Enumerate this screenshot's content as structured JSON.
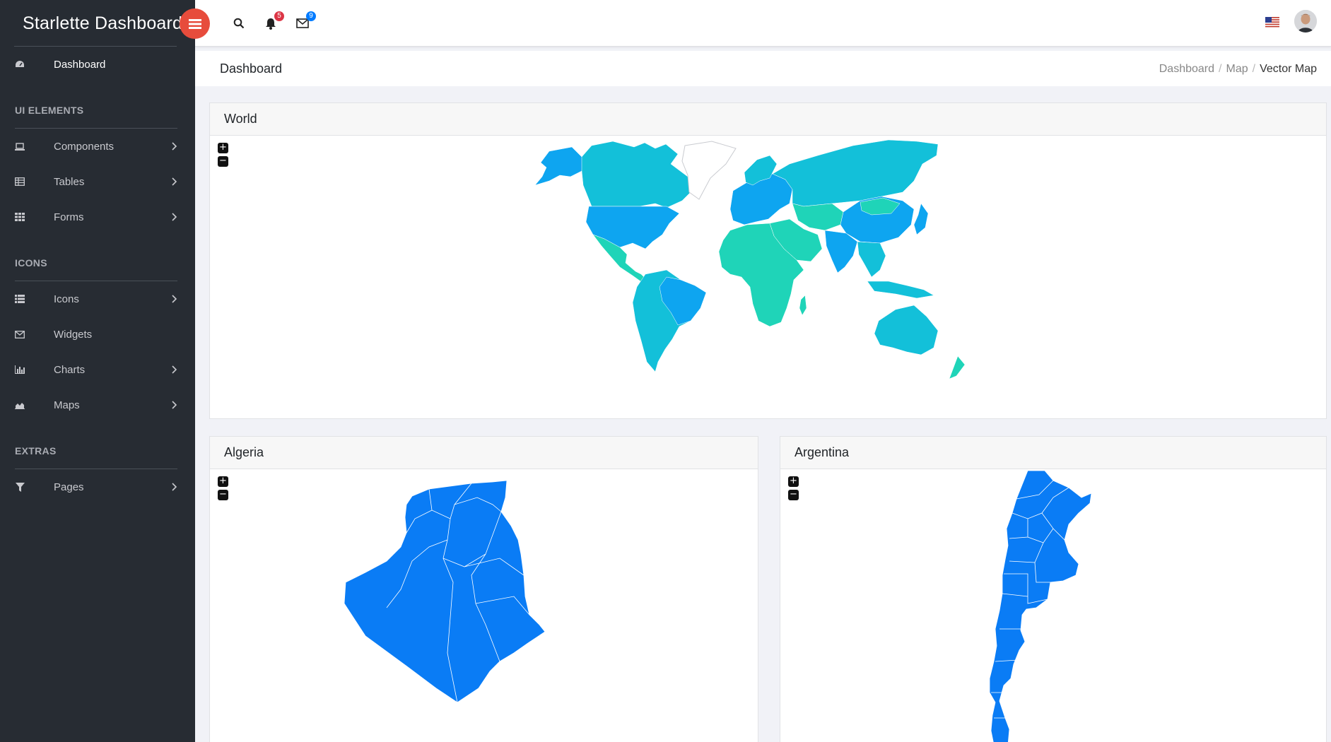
{
  "app": {
    "title": "Starlette Dashboard"
  },
  "sidebar": {
    "items": [
      {
        "label": "Dashboard",
        "icon": "dashboard-icon"
      },
      {
        "label": "Components",
        "icon": "laptop-icon"
      },
      {
        "label": "Tables",
        "icon": "table-icon"
      },
      {
        "label": "Forms",
        "icon": "grid-icon"
      },
      {
        "label": "Icons",
        "icon": "list-icon"
      },
      {
        "label": "Widgets",
        "icon": "envelope-icon"
      },
      {
        "label": "Charts",
        "icon": "bar-chart-icon"
      },
      {
        "label": "Maps",
        "icon": "area-chart-icon"
      },
      {
        "label": "Pages",
        "icon": "filter-icon"
      }
    ],
    "sections": [
      "UI ELEMENTS",
      "ICONS",
      "EXTRAS"
    ]
  },
  "header": {
    "notifications_count": "5",
    "messages_count": "9",
    "language_flag": "us-flag-icon"
  },
  "page": {
    "title": "Dashboard",
    "breadcrumb": [
      "Dashboard",
      "Map",
      "Vector Map"
    ]
  },
  "maps": {
    "world": {
      "title": "World",
      "zoom_in": "+",
      "zoom_out": "−"
    },
    "algeria": {
      "title": "Algeria",
      "zoom_in": "+",
      "zoom_out": "−"
    },
    "argentina": {
      "title": "Argentina",
      "zoom_in": "+",
      "zoom_out": "−"
    }
  },
  "colors": {
    "sidebar_bg": "#272c33",
    "accent_red": "#e74c3c",
    "map_blue": "#0a7cf5",
    "map_cyan": "#13c0d9",
    "map_teal": "#1fd4b8"
  }
}
